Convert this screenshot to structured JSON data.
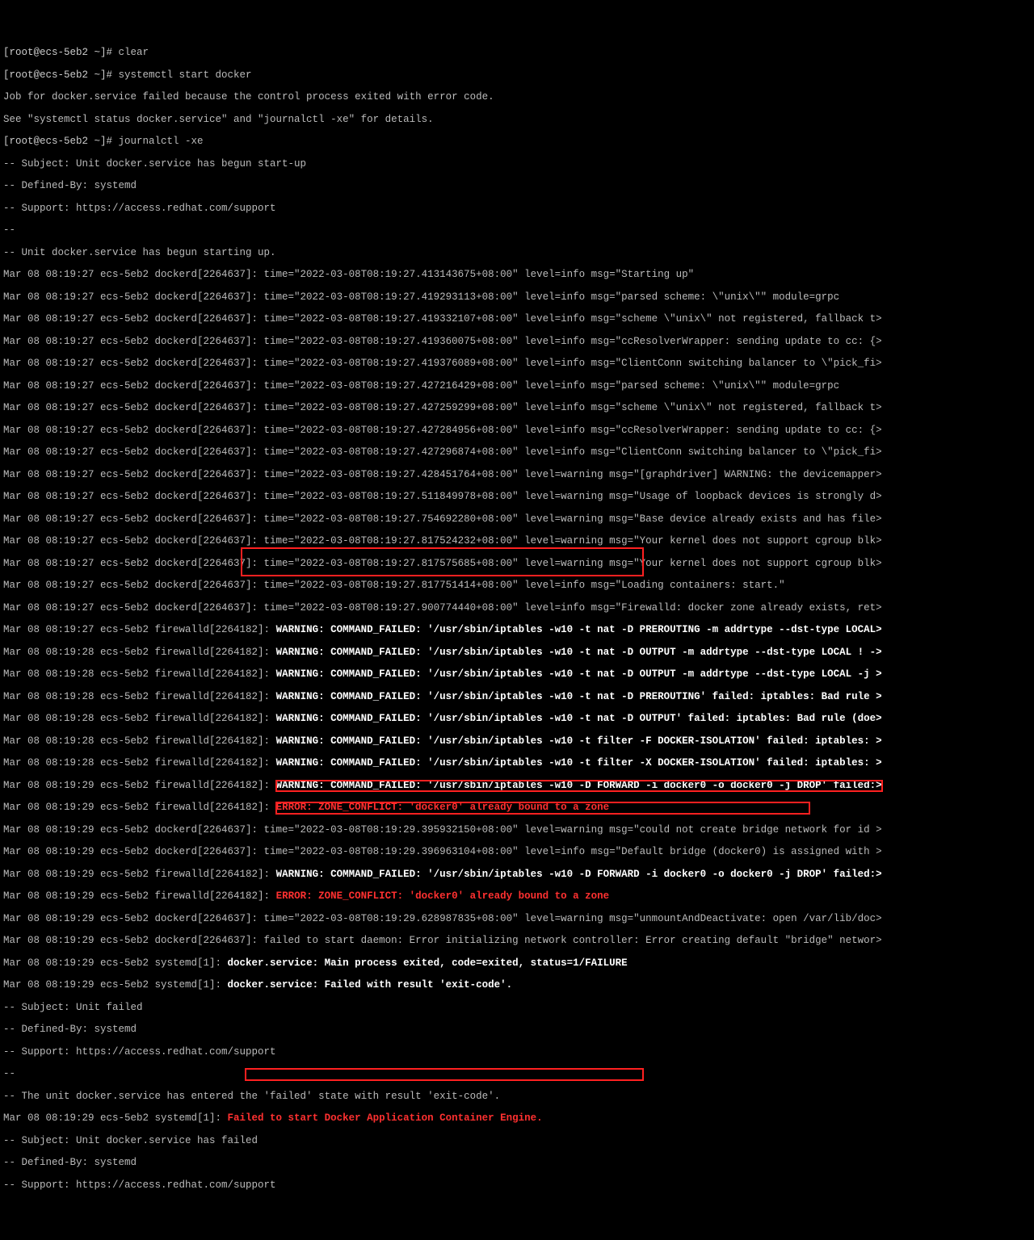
{
  "prompt1": "[root@ecs-5eb2 ~]# ",
  "cmd1": "clear",
  "prompt2": "[root@ecs-5eb2 ~]# ",
  "cmd2": "systemctl start docker",
  "job_fail": "Job for docker.service failed because the control process exited with error code.",
  "see": "See \"systemctl status docker.service\" and \"journalctl -xe\" for details.",
  "prompt3": "[root@ecs-5eb2 ~]# ",
  "cmd3": "journalctl -xe",
  "subj1": "-- Subject: Unit docker.service has begun start-up",
  "def1": "-- Defined-By: systemd",
  "sup1": "-- Support: https://access.redhat.com/support",
  "blank1": "--",
  "starting": "-- Unit docker.service has begun starting up.",
  "d01": "Mar 08 08:19:27 ecs-5eb2 dockerd[2264637]: time=\"2022-03-08T08:19:27.413143675+08:00\" level=info msg=\"Starting up\"",
  "d02": "Mar 08 08:19:27 ecs-5eb2 dockerd[2264637]: time=\"2022-03-08T08:19:27.419293113+08:00\" level=info msg=\"parsed scheme: \\\"unix\\\"\" module=grpc",
  "d03": "Mar 08 08:19:27 ecs-5eb2 dockerd[2264637]: time=\"2022-03-08T08:19:27.419332107+08:00\" level=info msg=\"scheme \\\"unix\\\" not registered, fallback t>",
  "d04": "Mar 08 08:19:27 ecs-5eb2 dockerd[2264637]: time=\"2022-03-08T08:19:27.419360075+08:00\" level=info msg=\"ccResolverWrapper: sending update to cc: {>",
  "d05": "Mar 08 08:19:27 ecs-5eb2 dockerd[2264637]: time=\"2022-03-08T08:19:27.419376089+08:00\" level=info msg=\"ClientConn switching balancer to \\\"pick_fi>",
  "d06": "Mar 08 08:19:27 ecs-5eb2 dockerd[2264637]: time=\"2022-03-08T08:19:27.427216429+08:00\" level=info msg=\"parsed scheme: \\\"unix\\\"\" module=grpc",
  "d07": "Mar 08 08:19:27 ecs-5eb2 dockerd[2264637]: time=\"2022-03-08T08:19:27.427259299+08:00\" level=info msg=\"scheme \\\"unix\\\" not registered, fallback t>",
  "d08": "Mar 08 08:19:27 ecs-5eb2 dockerd[2264637]: time=\"2022-03-08T08:19:27.427284956+08:00\" level=info msg=\"ccResolverWrapper: sending update to cc: {>",
  "d09": "Mar 08 08:19:27 ecs-5eb2 dockerd[2264637]: time=\"2022-03-08T08:19:27.427296874+08:00\" level=info msg=\"ClientConn switching balancer to \\\"pick_fi>",
  "d10": "Mar 08 08:19:27 ecs-5eb2 dockerd[2264637]: time=\"2022-03-08T08:19:27.428451764+08:00\" level=warning msg=\"[graphdriver] WARNING: the devicemapper>",
  "d11": "Mar 08 08:19:27 ecs-5eb2 dockerd[2264637]: time=\"2022-03-08T08:19:27.511849978+08:00\" level=warning msg=\"Usage of loopback devices is strongly d>",
  "d12": "Mar 08 08:19:27 ecs-5eb2 dockerd[2264637]: time=\"2022-03-08T08:19:27.754692280+08:00\" level=warning msg=\"Base device already exists and has file>",
  "d13": "Mar 08 08:19:27 ecs-5eb2 dockerd[2264637]: time=\"2022-03-08T08:19:27.817524232+08:00\" level=warning msg=\"Your kernel does not support cgroup blk>",
  "d14": "Mar 08 08:19:27 ecs-5eb2 dockerd[2264637]: time=\"2022-03-08T08:19:27.817575685+08:00\" level=warning msg=\"Your kernel does not support cgroup blk>",
  "d15": "Mar 08 08:19:27 ecs-5eb2 dockerd[2264637]: time=\"2022-03-08T08:19:27.817751414+08:00\" level=info msg=\"Loading containers: start.\"",
  "d16": "Mar 08 08:19:27 ecs-5eb2 dockerd[2264637]: time=\"2022-03-08T08:19:27.900774440+08:00\" level=info msg=\"Firewalld: docker zone already exists, ret>",
  "f01_pre": "Mar 08 08:19:27 ecs-5eb2 firewalld[2264182]: ",
  "f01_b": "WARNING: COMMAND_FAILED: '/usr/sbin/iptables -w10 -t nat -D PREROUTING -m addrtype --dst-type LOCAL>",
  "f02_pre": "Mar 08 08:19:28 ecs-5eb2 firewalld[2264182]: ",
  "f02_b": "WARNING: COMMAND_FAILED: '/usr/sbin/iptables -w10 -t nat -D OUTPUT -m addrtype --dst-type LOCAL ! ->",
  "f03_pre": "Mar 08 08:19:28 ecs-5eb2 firewalld[2264182]: ",
  "f03_b": "WARNING: COMMAND_FAILED: '/usr/sbin/iptables -w10 -t nat -D OUTPUT -m addrtype --dst-type LOCAL -j >",
  "f04_pre": "Mar 08 08:19:28 ecs-5eb2 firewalld[2264182]: ",
  "f04_b": "WARNING: COMMAND_FAILED: '/usr/sbin/iptables -w10 -t nat -D PREROUTING' failed: iptables: Bad rule >",
  "f05_pre": "Mar 08 08:19:28 ecs-5eb2 firewalld[2264182]: ",
  "f05_b": "WARNING: COMMAND_FAILED: '/usr/sbin/iptables -w10 -t nat -D OUTPUT' failed: iptables: Bad rule (doe>",
  "f06_pre": "Mar 08 08:19:28 ecs-5eb2 firewalld[2264182]: ",
  "f06_b": "WARNING: COMMAND_FAILED: '/usr/sbin/iptables -w10 -t filter -F DOCKER-ISOLATION' failed: iptables: >",
  "f07_pre": "Mar 08 08:19:28 ecs-5eb2 firewalld[2264182]: ",
  "f07_b": "WARNING: COMMAND_FAILED: '/usr/sbin/iptables -w10 -t filter -X DOCKER-ISOLATION' failed: iptables: >",
  "f08_pre": "Mar 08 08:19:29 ecs-5eb2 firewalld[2264182]: ",
  "f08_b": "WARNING: COMMAND_FAILED: '/usr/sbin/iptables -w10 -D FORWARD -i docker0 -o docker0 -j DROP' failed:>",
  "f09_pre": "Mar 08 08:19:29 ecs-5eb2 firewalld[2264182]: ",
  "f09_r": "ERROR: ZONE_CONFLICT: 'docker0' already bound to a zone",
  "d17": "Mar 08 08:19:29 ecs-5eb2 dockerd[2264637]: time=\"2022-03-08T08:19:29.395932150+08:00\" level=warning msg=\"could not create bridge network for id >",
  "d18": "Mar 08 08:19:29 ecs-5eb2 dockerd[2264637]: time=\"2022-03-08T08:19:29.396963104+08:00\" level=info msg=\"Default bridge (docker0) is assigned with >",
  "f10_pre": "Mar 08 08:19:29 ecs-5eb2 firewalld[2264182]: ",
  "f10_b": "WARNING: COMMAND_FAILED: '/usr/sbin/iptables -w10 -D FORWARD -i docker0 -o docker0 -j DROP' failed:>",
  "f11_pre": "Mar 08 08:19:29 ecs-5eb2 firewalld[2264182]: ",
  "f11_r": "ERROR: ZONE_CONFLICT: 'docker0' already bound to a zone",
  "d19": "Mar 08 08:19:29 ecs-5eb2 dockerd[2264637]: time=\"2022-03-08T08:19:29.628987835+08:00\" level=warning msg=\"unmountAndDeactivate: open /var/lib/doc>",
  "d20": "Mar 08 08:19:29 ecs-5eb2 dockerd[2264637]: failed to start daemon: Error initializing network controller: Error creating default \"bridge\" networ>",
  "s1_pre": "Mar 08 08:19:29 ecs-5eb2 systemd[1]: ",
  "s1_b": "docker.service: Main process exited, code=exited, status=1/FAILURE",
  "s2_pre": "Mar 08 08:19:29 ecs-5eb2 systemd[1]: ",
  "s2_b": "docker.service: Failed with result 'exit-code'.",
  "subj2": "-- Subject: Unit failed",
  "def2": "-- Defined-By: systemd",
  "sup2": "-- Support: https://access.redhat.com/support",
  "blank2": "--",
  "failed_state": "-- The unit docker.service has entered the 'failed' state with result 'exit-code'.",
  "s3_pre": "Mar 08 08:19:29 ecs-5eb2 systemd[1]: ",
  "s3_r": "Failed to start Docker Application Container Engine.",
  "subj3": "-- Subject: Unit docker.service has failed",
  "def3": "-- Defined-By: systemd",
  "sup3": "-- Support: https://access.redhat.com/support"
}
